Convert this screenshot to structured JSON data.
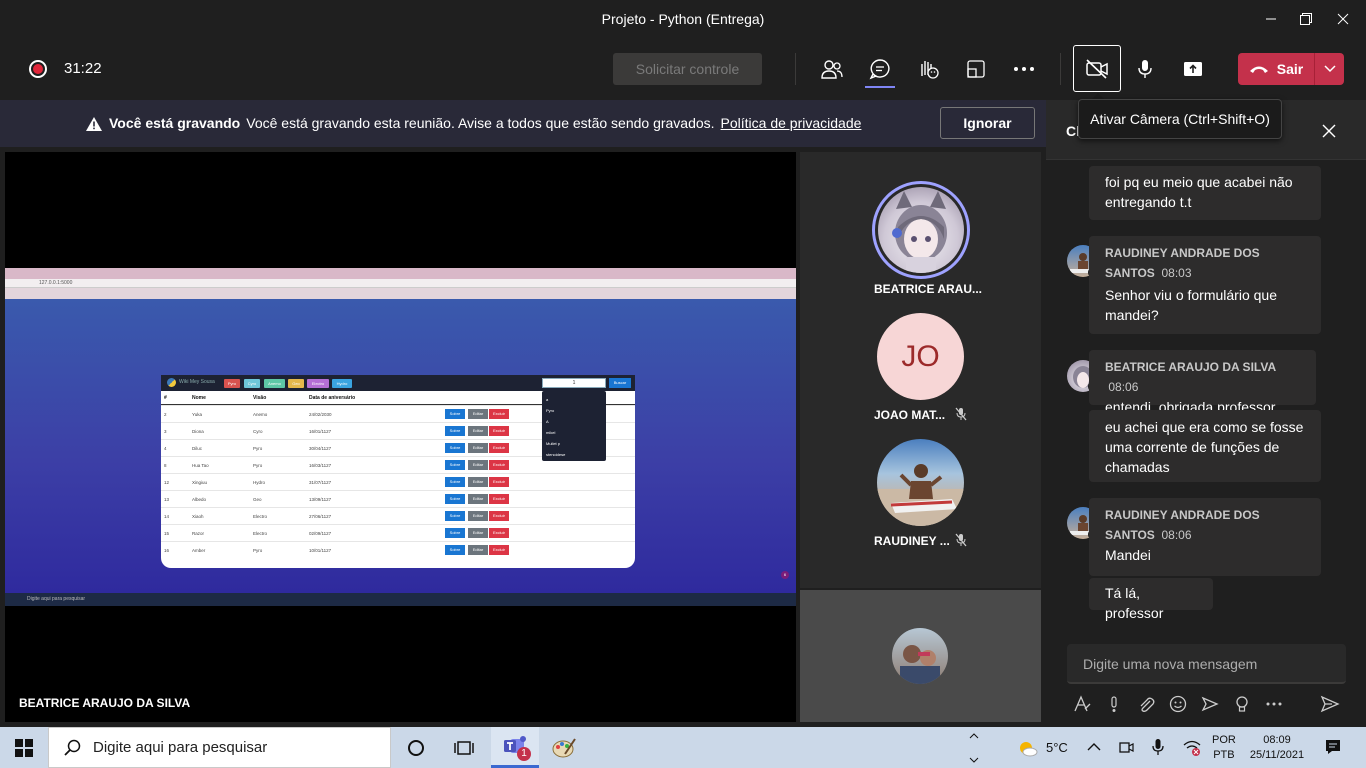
{
  "window": {
    "title": "Projeto - Python (Entrega)"
  },
  "meeting": {
    "timer": "31:22",
    "control_button": "Solicitar controle",
    "leave_label": "Sair"
  },
  "banner": {
    "bold": "Você está gravando",
    "message": "Você está gravando esta reunião. Avise a todos que estão sendo gravados.",
    "link": "Política de privacidade",
    "ignore": "Ignorar"
  },
  "tooltip": "Ativar Câmera (Ctrl+Shift+O)",
  "stage": {
    "presenter": "BEATRICE ARAUJO DA SILVA",
    "shared_app": {
      "url": "127.0.0.1:5000",
      "brand": "Wiki Mey Sousa",
      "nav": [
        "Pyro",
        "Cyro",
        "Anemo",
        "Geo",
        "Electro",
        "Hydro"
      ],
      "nav_colors": [
        "#d9534f",
        "#6ec6d9",
        "#5ec7a6",
        "#e5b84c",
        "#b56fd6",
        "#3aa4e0"
      ],
      "search_value": "1",
      "search_button": "Buscar",
      "dropdown": [
        "a",
        "Pyro",
        "A",
        "mikel",
        "Mullet p",
        "stenoidese"
      ],
      "headers": [
        "#",
        "Nome",
        "Visão",
        "Data de aniversário"
      ],
      "rows": [
        [
          "2",
          "Yuka",
          "Anemo",
          "24/02/2030"
        ],
        [
          "3",
          "Diona",
          "Cyro",
          "16/01/1127"
        ],
        [
          "4",
          "Diluc",
          "Pyro",
          "30/04/1127"
        ],
        [
          "8",
          "Hua Tao",
          "Pyro",
          "16/03/1127"
        ],
        [
          "12",
          "Xingiuu",
          "Hydro",
          "31/07/1127"
        ],
        [
          "13",
          "Albedo",
          "Geo",
          "13/09/1127"
        ],
        [
          "14",
          "Xiaoh",
          "Electro",
          "27/06/1127"
        ],
        [
          "15",
          "Razor",
          "Electro",
          "02/09/1127"
        ],
        [
          "16",
          "Amber",
          "Pyro",
          "10/01/1127"
        ]
      ],
      "row_buttons": [
        "Sobre",
        "Editar",
        "Excluir"
      ],
      "taskbar_search": "Digite aqui para pesquisar"
    }
  },
  "participants": [
    {
      "name": "BEATRICE ARAU...",
      "mic": "on"
    },
    {
      "name": "JOAO MAT...",
      "initials": "JO",
      "mic": "off"
    },
    {
      "name": "RAUDINEY ...",
      "mic": "off"
    }
  ],
  "chat": {
    "title": "Chat",
    "messages": [
      {
        "text": "foi pq eu meio que acabei não entregando t.t"
      },
      {
        "sender": "RAUDINEY ANDRADE DOS SANTOS",
        "time": "08:03",
        "text": "Senhor viu o formulário que mandei?"
      },
      {
        "sender": "BEATRICE ARAUJO DA SILVA",
        "time": "08:06",
        "text": "entendi, obrigada professor"
      },
      {
        "text": "eu achei que era como se fosse uma corrente de funções de chamadas"
      },
      {
        "sender": "RAUDINEY ANDRADE DOS SANTOS",
        "time": "08:06",
        "text": "Mandei"
      },
      {
        "text": "Tá lá, professor"
      }
    ],
    "input_placeholder": "Digite uma nova mensagem"
  },
  "taskbar": {
    "search": "Digite aqui para pesquisar",
    "teams_badge": "1",
    "temperature": "5°C",
    "lang1": "POR",
    "lang2": "PTB",
    "time": "08:09",
    "date": "25/11/2021"
  },
  "colors": {
    "accent": "#7f85f5",
    "leave": "#c4314b",
    "banner": "#292938"
  }
}
